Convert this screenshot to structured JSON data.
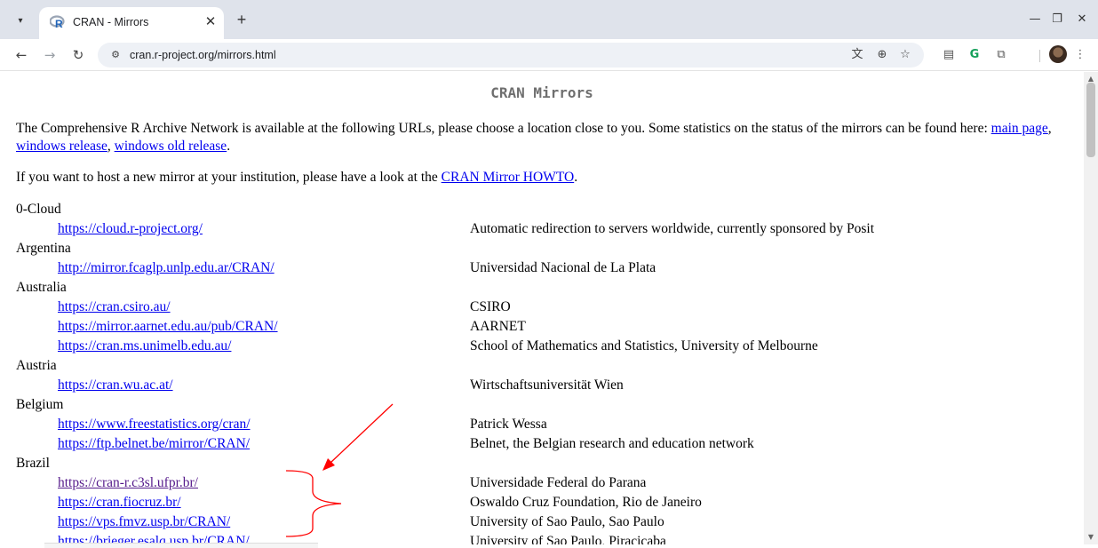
{
  "browser": {
    "tab_title": "CRAN - Mirrors",
    "url": "cran.r-project.org/mirrors.html",
    "favicon_letter": "R"
  },
  "page": {
    "title": "CRAN Mirrors",
    "intro": {
      "text_before": "The Comprehensive R Archive Network is available at the following URLs, please choose a location close to you. Some statistics on the status of the mirrors can be found here: ",
      "link1": "main page",
      "sep1": ", ",
      "link2": "windows release",
      "sep2": ", ",
      "link3": "windows old release",
      "text_after": "."
    },
    "host": {
      "text_before": "If you want to host a new mirror at your institution, please have a look at the ",
      "link": "CRAN Mirror HOWTO",
      "text_after": "."
    },
    "mirrors": [
      {
        "country": "0-Cloud"
      },
      {
        "url": "https://cloud.r-project.org/",
        "desc": "Automatic redirection to servers worldwide, currently sponsored by Posit"
      },
      {
        "country": "Argentina"
      },
      {
        "url": "http://mirror.fcaglp.unlp.edu.ar/CRAN/",
        "desc": "Universidad Nacional de La Plata"
      },
      {
        "country": "Australia"
      },
      {
        "url": "https://cran.csiro.au/",
        "desc": "CSIRO"
      },
      {
        "url": "https://mirror.aarnet.edu.au/pub/CRAN/",
        "desc": "AARNET"
      },
      {
        "url": "https://cran.ms.unimelb.edu.au/",
        "desc": "School of Mathematics and Statistics, University of Melbourne"
      },
      {
        "country": "Austria"
      },
      {
        "url": "https://cran.wu.ac.at/",
        "desc": "Wirtschaftsuniversität Wien"
      },
      {
        "country": "Belgium"
      },
      {
        "url": "https://www.freestatistics.org/cran/",
        "desc": "Patrick Wessa"
      },
      {
        "url": "https://ftp.belnet.be/mirror/CRAN/",
        "desc": "Belnet, the Belgian research and education network"
      },
      {
        "country": "Brazil"
      },
      {
        "url": "https://cran-r.c3sl.ufpr.br/",
        "desc": "Universidade Federal do Parana",
        "visited": true
      },
      {
        "url": "https://cran.fiocruz.br/",
        "desc": "Oswaldo Cruz Foundation, Rio de Janeiro"
      },
      {
        "url": "https://vps.fmvz.usp.br/CRAN/",
        "desc": "University of Sao Paulo, Sao Paulo"
      },
      {
        "url": "https://brieger.esalq.usp.br/CRAN/",
        "desc": "University of Sao Paulo, Piracicaba"
      }
    ]
  },
  "colors": {
    "link": "#0000ee",
    "visited_link": "#551a8b",
    "annotation": "#ff0000",
    "tabstrip": "#dfe3eb"
  },
  "icons": [
    "tab-search-icon",
    "r-logo-icon",
    "close-icon",
    "plus-icon",
    "minimize-icon",
    "restore-icon",
    "back-arrow-icon",
    "forward-arrow-icon",
    "reload-icon",
    "site-info-icon",
    "translate-icon",
    "zoom-icon",
    "star-icon",
    "reading-mode-icon",
    "grammarly-icon",
    "extensions-icon",
    "menu-dots-icon"
  ]
}
